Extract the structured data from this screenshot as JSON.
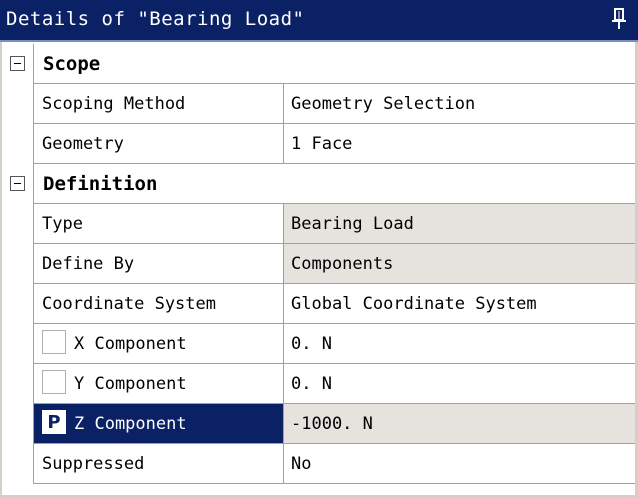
{
  "window": {
    "title": "Details of \"Bearing Load\"",
    "pin_icon": "pin-icon"
  },
  "scope": {
    "label": "Scope",
    "rows": [
      {
        "name": "Scoping Method",
        "value": "Geometry Selection"
      },
      {
        "name": "Geometry",
        "value": "1 Face"
      }
    ]
  },
  "definition": {
    "label": "Definition",
    "rows": [
      {
        "name": "Type",
        "value": "Bearing Load"
      },
      {
        "name": "Define By",
        "value": "Components"
      },
      {
        "name": "Coordinate System",
        "value": "Global Coordinate System"
      },
      {
        "name": "X Component",
        "value": "0. N"
      },
      {
        "name": "Y Component",
        "value": "0. N"
      },
      {
        "name": "Z Component",
        "value": "-1000. N",
        "badge": "P"
      },
      {
        "name": "Suppressed",
        "value": "No"
      }
    ]
  },
  "colors": {
    "titlebar": "#0b2166",
    "selected": "#0b2166",
    "readonly": "#e6e3df",
    "gridline": "#a0a0a0"
  }
}
